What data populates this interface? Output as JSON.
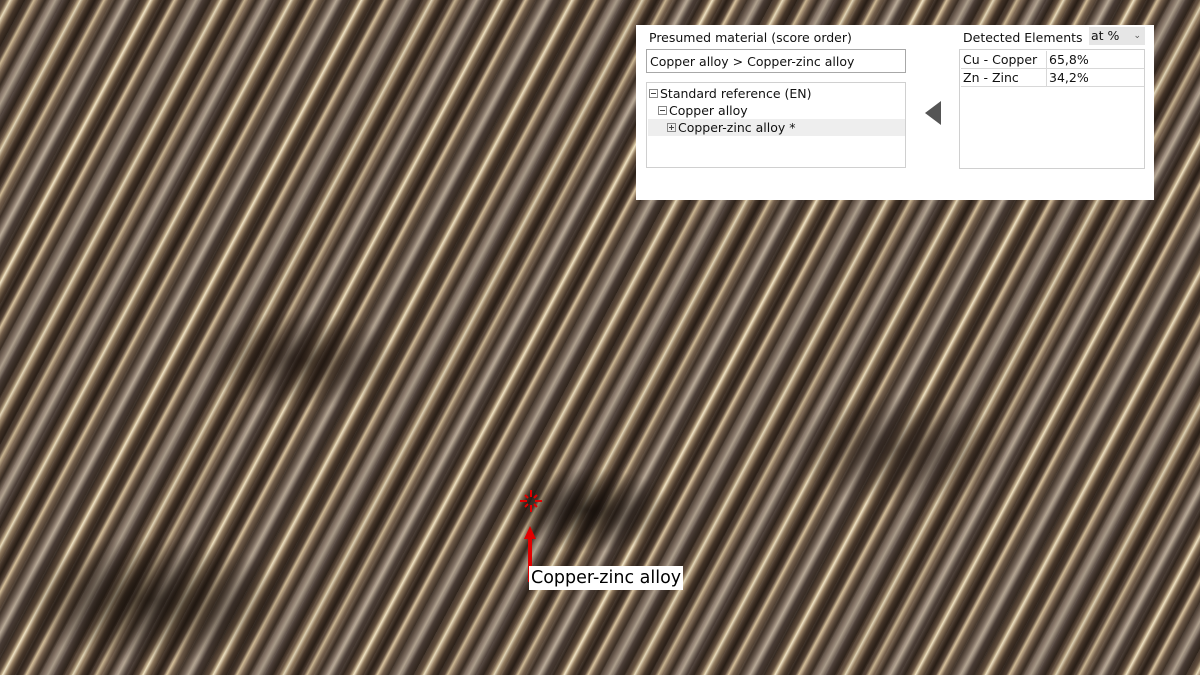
{
  "panel": {
    "material_heading": "Presumed material (score order)",
    "material_value": "Copper alloy > Copper-zinc alloy",
    "tree": [
      {
        "label": "Standard reference (EN)",
        "level": 0,
        "toggle": "collapse"
      },
      {
        "label": "Copper alloy",
        "level": 1,
        "toggle": "collapse"
      },
      {
        "label": "Copper-zinc alloy *",
        "level": 2,
        "toggle": "expand",
        "selected": true
      }
    ],
    "elements_heading": "Detected Elements",
    "unit_select": "at %",
    "elements": [
      {
        "name": "Cu - Copper",
        "value": "65,8%"
      },
      {
        "name": "Zn - Zinc",
        "value": "34,2%"
      }
    ]
  },
  "annotation": {
    "label": "Copper-zinc alloy",
    "color": "#e00000"
  }
}
